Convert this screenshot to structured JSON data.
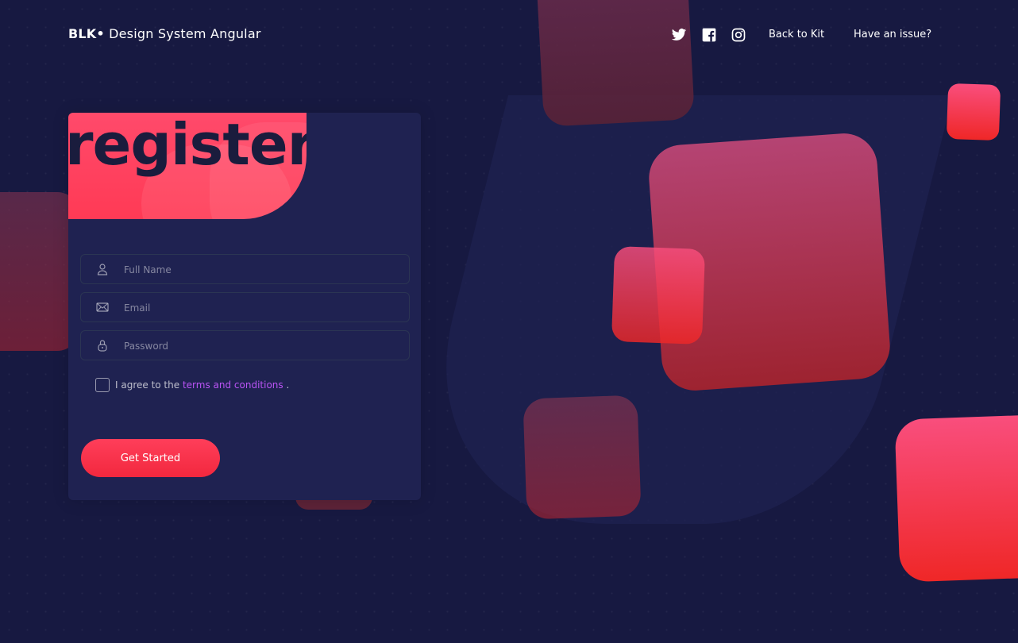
{
  "navbar": {
    "brand_bold": "BLK•",
    "brand_text": " Design System Angular",
    "social": [
      "twitter-icon",
      "facebook-icon",
      "instagram-icon"
    ],
    "links": [
      "Back to Kit",
      "Have an issue?"
    ]
  },
  "register": {
    "title": "register",
    "fields": [
      {
        "icon": "user-icon",
        "placeholder": "Full Name",
        "value": ""
      },
      {
        "icon": "envelope-icon",
        "placeholder": "Email",
        "value": ""
      },
      {
        "icon": "lock-icon",
        "placeholder": "Password",
        "value": ""
      }
    ],
    "agree_prefix": "I agree to the ",
    "agree_link": "terms and conditions",
    "agree_suffix": " .",
    "submit_label": "Get Started"
  },
  "colors": {
    "background": "#171941",
    "card": "#1f2251",
    "accent": "#ff3a55",
    "link": "#ba54f5"
  }
}
